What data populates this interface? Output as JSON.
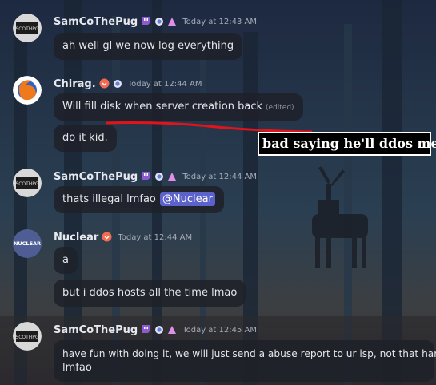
{
  "messages": [
    {
      "username": "SamCoThePug",
      "timestamp": "Today at 12:43 AM",
      "lines": [
        "ah well gl we now log everything"
      ]
    },
    {
      "username": "Chirag.",
      "timestamp": "Today at 12:44 AM",
      "lines": [
        "Will fill disk when server creation back",
        "do it kid."
      ],
      "edited": "(edited)"
    },
    {
      "username": "SamCoThePug",
      "timestamp": "Today at 12:44 AM",
      "lines": [
        "thats illegal lmfao"
      ],
      "mention": "@Nuclear"
    },
    {
      "username": "Nuclear",
      "avatar_text": "NUCLEAR",
      "timestamp": "Today at 12:44 AM",
      "lines": [
        "a",
        "but i ddos hosts all the time lmao"
      ]
    },
    {
      "username": "SamCoThePug",
      "timestamp": "Today at 12:45 AM",
      "lines": [
        "have fun with doing it, we will just send a abuse report to ur isp, not that hard",
        "lmfao"
      ]
    }
  ],
  "annotation": "bad saying he'll ddos me",
  "colors": {
    "username": "#e6e8ee",
    "timestamp": "#a5acb8",
    "bubble_bg": "#1e2129",
    "mention_bg": "#5b62c9",
    "underline": "#e0141a",
    "badge_purple": "#8d5ad1",
    "badge_orange": "#f06b52",
    "badge_pink": "#e08ee9",
    "badge_gray": "#6d7bd0"
  }
}
